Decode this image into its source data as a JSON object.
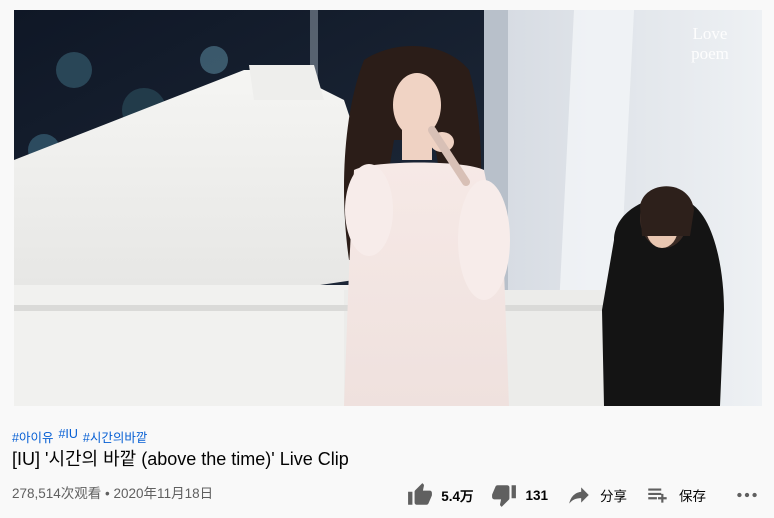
{
  "video": {
    "channel_watermark": [
      "Love",
      "poem"
    ]
  },
  "hashtags": [
    "#아이유",
    "#IU",
    "#시간의바깥"
  ],
  "title": "[IU] '시간의 바깥 (above the time)' Live Clip",
  "meta": "278,514次观看 • 2020年11月18日",
  "actions": {
    "like_count": "5.4万",
    "dislike_count": "131",
    "share_label": "分享",
    "save_label": "保存"
  },
  "icons": [
    "thumb-up-icon",
    "thumb-down-icon",
    "share-icon",
    "playlist-add-icon",
    "more-icon"
  ]
}
